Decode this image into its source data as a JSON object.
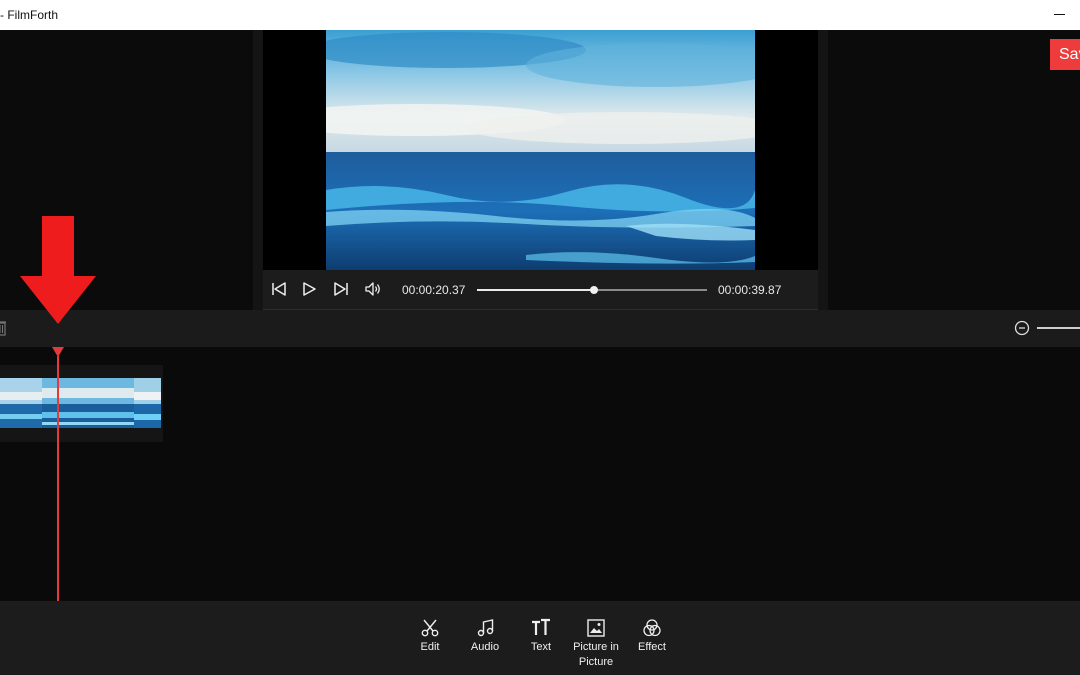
{
  "window": {
    "title": "- FilmForth"
  },
  "header": {
    "save_label": "Save"
  },
  "player": {
    "current_time": "00:00:20.37",
    "total_time": "00:00:39.87",
    "progress": 0.51
  },
  "colors": {
    "accent": "#ee3b3b",
    "playhead": "#e43a3a",
    "background": "#0a0a0a",
    "toolbar": "#1c1c1c"
  },
  "toolbar": {
    "items": [
      {
        "label": "Edit",
        "icon": "scissors-icon"
      },
      {
        "label": "Audio",
        "icon": "music-note-icon"
      },
      {
        "label": "Text",
        "icon": "text-icon"
      },
      {
        "label": "Picture in Picture",
        "icon": "image-icon"
      },
      {
        "label": "Effect",
        "icon": "effect-circles-icon"
      }
    ]
  },
  "icons": {
    "player": [
      "skip-back-icon",
      "play-icon",
      "skip-forward-icon",
      "volume-icon"
    ],
    "timeline": [
      "trash-icon",
      "zoom-out-icon"
    ],
    "annotation": "red-arrow-annotation"
  }
}
